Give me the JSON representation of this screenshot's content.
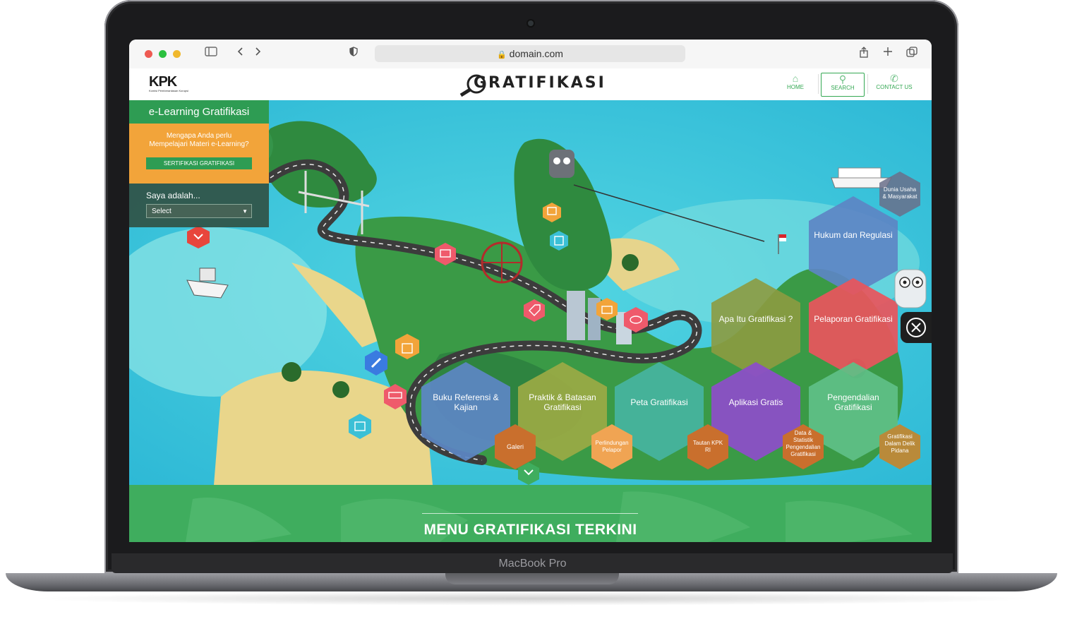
{
  "device": {
    "label": "MacBook Pro"
  },
  "browser": {
    "url": "domain.com"
  },
  "header": {
    "kpk_logo": "KPK",
    "kpk_subtitle": "Komisi Pemberantasan Korupsi",
    "site_logo": "GRATIFIKASI",
    "nav": [
      {
        "label": "HOME",
        "icon": "home-icon"
      },
      {
        "label": "SEARCH",
        "icon": "search-icon"
      },
      {
        "label": "CONTACT US",
        "icon": "phone-icon"
      }
    ]
  },
  "elearning": {
    "title": "e-Learning Gratifikasi",
    "question_line1": "Mengapa Anda perlu",
    "question_line2": "Mempelajari Materi e-Learning?",
    "cert_button": "SERTIFIKASI GRATIFIKASI",
    "saya_label": "Saya adalah...",
    "select_value": "Select"
  },
  "menu_hexes": {
    "hukum": "Hukum dan Regulasi",
    "apa_itu": "Apa Itu Gratifikasi ?",
    "pelaporan": "Pelaporan Gratifikasi",
    "buku_1": "Buku Referensi &",
    "buku_2": "Kajian",
    "praktik_1": "Praktik & Batasan",
    "praktik_2": "Gratifikasi",
    "peta": "Peta Gratifikasi",
    "aplikasi": "Aplikasi Gratis",
    "pengendalian_1": "Pengendalian",
    "pengendalian_2": "Gratifikasi"
  },
  "small_hexes": {
    "dunia_1": "Dunia Usaha",
    "dunia_2": "& Masyarakat",
    "galeri": "Galeri",
    "perlindungan_1": "Perlindungan",
    "perlindungan_2": "Pelapor",
    "tautan_1": "Tautan KPK",
    "tautan_2": "RI",
    "data_1": "Data &",
    "data_2": "Statistik",
    "data_3": "Pengendalian",
    "data_4": "Gratifikasi",
    "delik_1": "Gratifikasi",
    "delik_2": "Dalam Delik",
    "delik_3": "Pidana"
  },
  "footer": {
    "menu_title": "MENU GRATIFIKASI TERKINI"
  },
  "colors": {
    "accent_green": "#2e9c53",
    "orange": "#f2a43a",
    "sea": "#35c9d9",
    "hex_blue": "#5d86c4",
    "hex_red": "#e8555d",
    "hex_olive": "#8d9b40",
    "hex_purple": "#8b4fc7",
    "hex_mint": "#5fbf86"
  }
}
